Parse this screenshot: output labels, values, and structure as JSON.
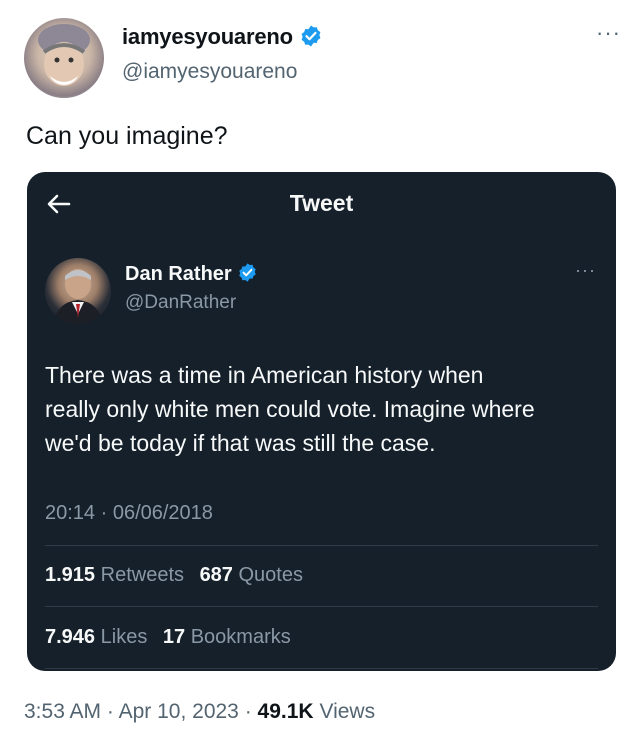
{
  "author": {
    "name": "iamyesyouareno",
    "handle": "@iamyesyouareno",
    "verified_icon": "verified-badge-icon",
    "more_label": "···"
  },
  "tweet": {
    "text": "Can you imagine?"
  },
  "quoted": {
    "header_title": "Tweet",
    "back_icon": "arrow-left-icon",
    "author_name": "Dan Rather",
    "author_handle": "@DanRather",
    "more_label": "···",
    "body_lines": [
      "There was a time in American history when",
      "really only white men could vote. Imagine where",
      "we'd be today if that was still the case."
    ],
    "timestamp": "20:14 · 06/06/2018",
    "retweets_count": "1.915",
    "retweets_label": "Retweets",
    "quotes_count": "687",
    "quotes_label": "Quotes",
    "likes_count": "7.946",
    "likes_label": "Likes",
    "bookmarks_count": "17",
    "bookmarks_label": "Bookmarks"
  },
  "footer": {
    "time": "3:53 AM",
    "separator": "·",
    "date": "Apr 10, 2023",
    "views_count": "49.1K",
    "views_label": "Views"
  },
  "colors": {
    "card_bg": "#15202b",
    "verified_blue": "#1d9bf0",
    "muted": "#536471"
  }
}
